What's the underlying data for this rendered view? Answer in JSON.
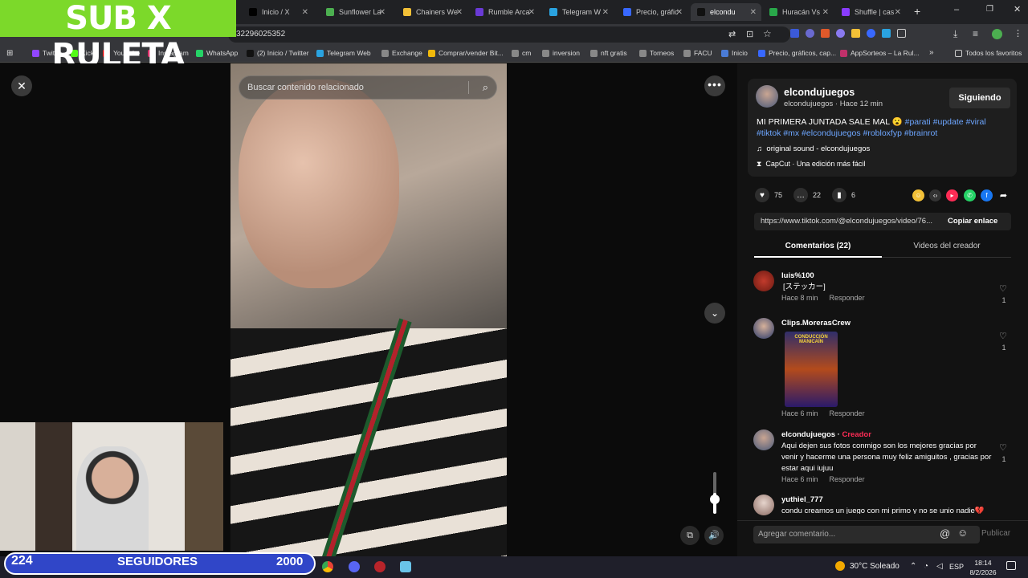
{
  "overlay": {
    "title": "SUB X RULETA",
    "followers_count": "224",
    "followers_label": "SEGUIDORES",
    "followers_goal": "2000"
  },
  "browser": {
    "tabs": [
      {
        "label": "Inicio / X",
        "icon": "x-icon",
        "color": "#000000"
      },
      {
        "label": "Sunflower La",
        "icon": "sunflower-icon",
        "color": "#4caf50"
      },
      {
        "label": "Chainers We",
        "icon": "chainers-icon",
        "color": "#f2c037"
      },
      {
        "label": "Rumble Arca",
        "icon": "rumble-icon",
        "color": "#6a3ad6"
      },
      {
        "label": "Telegram W",
        "icon": "telegram-icon",
        "color": "#2aa3e0"
      },
      {
        "label": "Precio, gráfic",
        "icon": "coingecko-icon",
        "color": "#3868ff"
      },
      {
        "label": "elcondu",
        "icon": "tiktok-icon",
        "color": "#111111"
      },
      {
        "label": "Huracán Vs",
        "icon": "huracan-icon",
        "color": "#29a84a"
      },
      {
        "label": "Shuffle | cas",
        "icon": "shuffle-icon",
        "color": "#8a3cff"
      }
    ],
    "url": "32296025352",
    "bookmarks": [
      {
        "label": "Twitch",
        "color": "#9146ff"
      },
      {
        "label": "Kick",
        "color": "#53fc18"
      },
      {
        "label": "YouTube",
        "color": "#ff0000"
      },
      {
        "label": "Instagram",
        "color": "#e1306c"
      },
      {
        "label": "WhatsApp",
        "color": "#25d366"
      },
      {
        "label": "(2) Inicio / Twitter",
        "color": "#111111"
      },
      {
        "label": "Telegram Web",
        "color": "#2aa3e0"
      },
      {
        "label": "Exchange",
        "color": "#888888"
      },
      {
        "label": "Comprar/vender Bit...",
        "color": "#f0b90b"
      },
      {
        "label": "cm",
        "color": "#888888"
      },
      {
        "label": "inversion",
        "color": "#888888"
      },
      {
        "label": "nft gratis",
        "color": "#888888"
      },
      {
        "label": "Torneos",
        "color": "#888888"
      },
      {
        "label": "FACU",
        "color": "#888888"
      },
      {
        "label": "Inicio",
        "color": "#4a7bd6"
      },
      {
        "label": "Precio, gráficos, cap...",
        "color": "#3868ff"
      },
      {
        "label": "AppSorteos – La Rul...",
        "color": "#c0306a"
      }
    ],
    "all_bookmarks": "Todos los favoritos"
  },
  "video": {
    "search_placeholder": "Buscar contenido relacionado",
    "volume": 0.5
  },
  "post": {
    "author": "elcondujuegos",
    "author_sub": "elcondujuegos · Hace 12 min",
    "follow_label": "Siguiendo",
    "desc_text": "MI PRIMERA JUNTADA SALE MAL 😮 ",
    "desc_tags_1": "#parati #update #viral",
    "desc_tags_2": "#tiktok #mx #elcondujuegos #robloxfyp #brainrot",
    "sound": "original sound - elcondujuegos",
    "capcut": "CapCut · Una edición más fácil",
    "likes": "75",
    "comments": "22",
    "saves": "6",
    "link": "https://www.tiktok.com/@elcondujuegos/video/76...",
    "copy_label": "Copiar enlace",
    "tab_comments": "Comentarios (22)",
    "tab_videos": "Videos del creador"
  },
  "comments": [
    {
      "user": "luis%100",
      "text": "[ステッカー]",
      "time": "Hace 8 min",
      "reply": "Responder",
      "likes": "1"
    },
    {
      "user": "Clips.MorerasCrew",
      "sticker": "CONDUCCIÓN MANICAÍN",
      "time": "Hace 6 min",
      "reply": "Responder",
      "likes": "1"
    },
    {
      "user": "elcondujuegos",
      "badge": "Creador",
      "text": "Aqui dejen sus fotos conmigo son los mejores gracias por venir y hacerme una persona muy feliz amiguitos , gracias por estar aqui iujuu",
      "time": "Hace 6 min",
      "reply": "Responder",
      "likes": "1"
    },
    {
      "user": "yuthiel_777",
      "text": "condu creamos un juego con mi primo y no se unio nadie💔",
      "time": "",
      "reply": "",
      "likes": ""
    }
  ],
  "comment_bar": {
    "placeholder": "Agregar comentario...",
    "publish": "Publicar"
  },
  "taskbar": {
    "weather": "30°C  Soleado",
    "lang": "ESP",
    "time": "18:14",
    "date": "8/2/2026"
  }
}
